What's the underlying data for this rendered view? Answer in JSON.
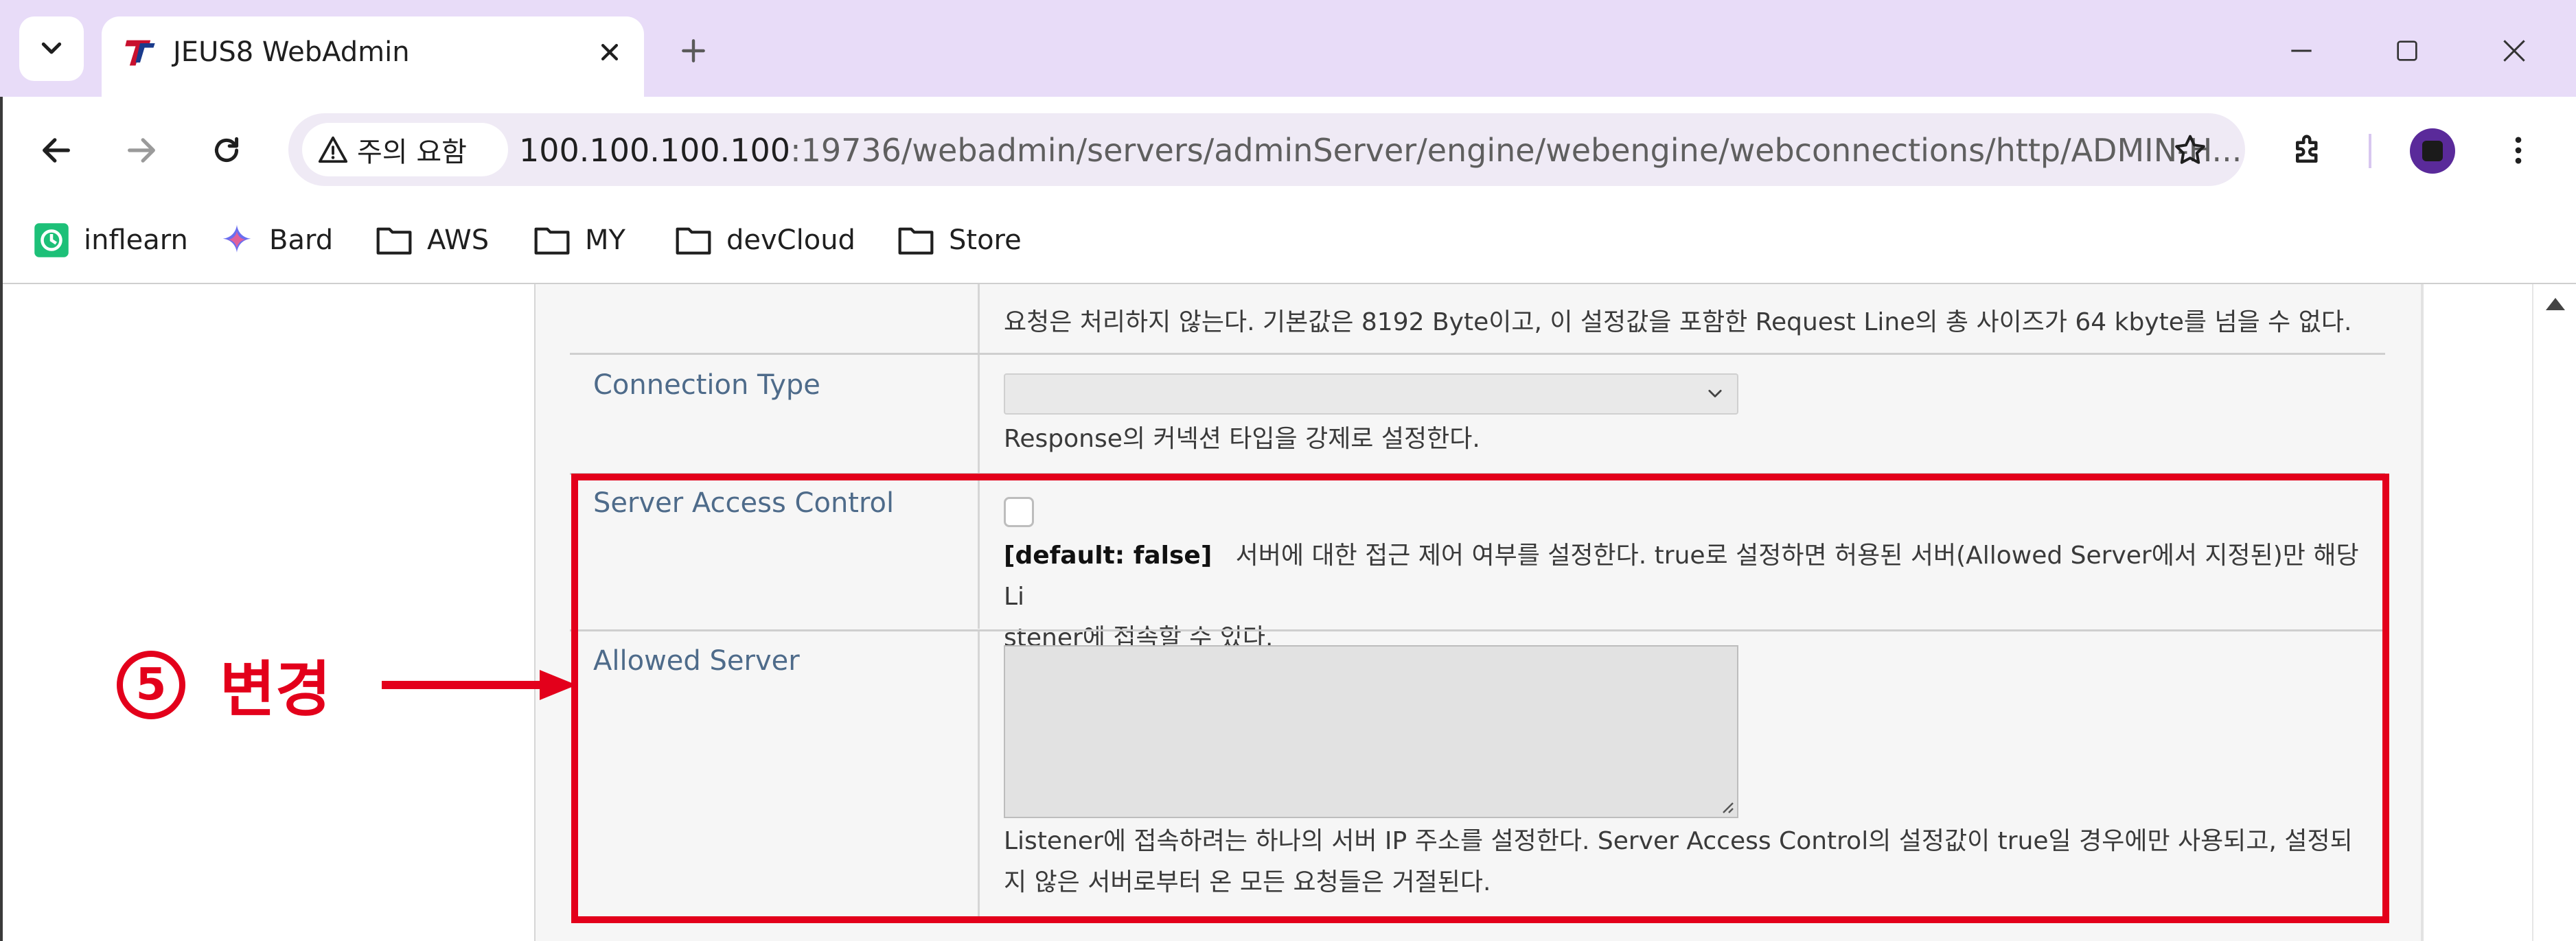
{
  "browser": {
    "tab_title": "JEUS8 WebAdmin",
    "security_chip": "주의 요함",
    "url_host": "100.100.100.100",
    "url_path": ":19736/webadmin/servers/adminServer/engine/webengine/webconnections/http/ADMIN-H..."
  },
  "bookmarks": [
    {
      "label": "inflearn",
      "icon": "inflearn-favicon-icon"
    },
    {
      "label": "Bard",
      "icon": "bard-sparkle-icon"
    },
    {
      "label": "AWS",
      "icon": "folder-icon"
    },
    {
      "label": "MY",
      "icon": "folder-icon"
    },
    {
      "label": "devCloud",
      "icon": "folder-icon"
    },
    {
      "label": "Store",
      "icon": "folder-icon"
    }
  ],
  "form": {
    "prev_desc": "요청은 처리하지 않는다. 기본값은 8192 Byte이고, 이 설정값을 포함한 Request Line의 총 사이즈가 64 kbyte를 넘을 수 없다.",
    "connection_type": {
      "label": "Connection Type",
      "value": "",
      "desc": "Response의 커넥션 타입을 강제로 설정한다."
    },
    "server_access_control": {
      "label": "Server Access Control",
      "checked": false,
      "default_tag": "[default: false]",
      "desc_line1": "서버에 대한 접근 제어 여부를 설정한다. true로 설정하면 허용된 서버(Allowed Server에서 지정된)만 해당 Li",
      "desc_line2": "stener에 접속할 수 있다."
    },
    "allowed_server": {
      "label": "Allowed Server",
      "value": "",
      "desc_line1": "Listener에 접속하려는 하나의 서버 IP 주소를 설정한다. Server Access Control의 설정값이 true일 경우에만 사용되고, 설정되",
      "desc_line2": "지 않은 서버로부터 온 모든 요청들은 거절된다."
    }
  },
  "annotation": {
    "number": "5",
    "text": "변경",
    "color": "#e3001b"
  }
}
